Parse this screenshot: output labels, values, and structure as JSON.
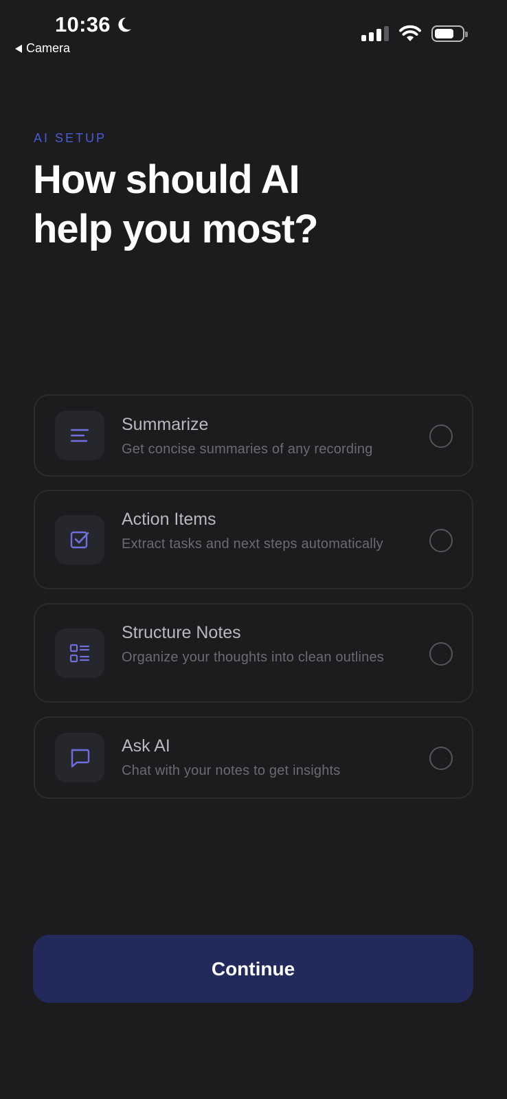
{
  "status_bar": {
    "time": "10:36",
    "back_label": "Camera",
    "battery_percent": 70,
    "signal_bars": 3
  },
  "header": {
    "eyebrow": "AI SETUP",
    "title": "How should AI\nhelp you most?"
  },
  "options": [
    {
      "title": "Summarize",
      "description": "Get concise summaries of any recording",
      "icon": "lines-icon",
      "selected": false
    },
    {
      "title": "Action Items",
      "description": "Extract tasks and next steps automatically",
      "icon": "checkbox-icon",
      "selected": false
    },
    {
      "title": "Structure Notes",
      "description": "Organize your thoughts into clean outlines",
      "icon": "outline-list-icon",
      "selected": false
    },
    {
      "title": "Ask AI",
      "description": "Chat with your notes to get insights",
      "icon": "chat-bubble-icon",
      "selected": false
    }
  ],
  "continue_label": "Continue",
  "colors": {
    "background": "#1c1c1e",
    "accent": "#4a5bd6",
    "icon_tint": "#6f6fe0",
    "button": "#222a5c"
  }
}
